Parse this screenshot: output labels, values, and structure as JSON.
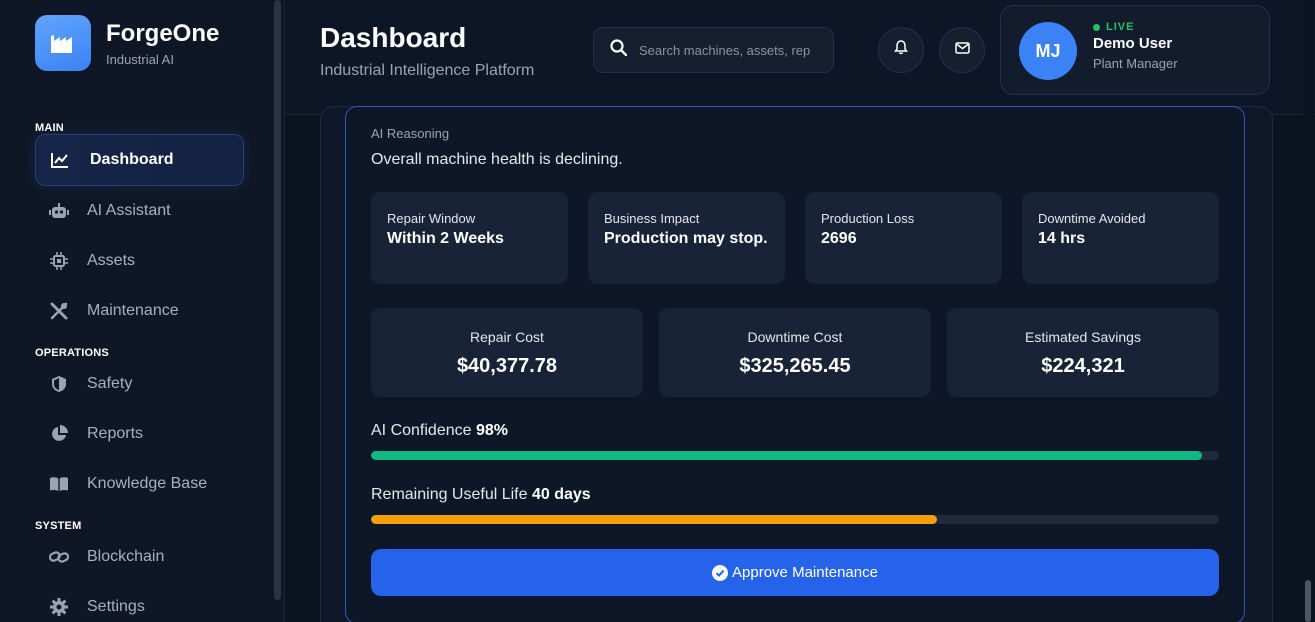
{
  "brand": {
    "name": "ForgeOne",
    "subtitle": "Industrial AI"
  },
  "sidebar": {
    "sections": [
      {
        "title": "MAIN",
        "items": [
          {
            "label": "Dashboard",
            "icon": "chart-line-icon",
            "active": true
          },
          {
            "label": "AI Assistant",
            "icon": "robot-icon"
          },
          {
            "label": "Assets",
            "icon": "chip-icon"
          },
          {
            "label": "Maintenance",
            "icon": "tools-icon"
          }
        ]
      },
      {
        "title": "OPERATIONS",
        "items": [
          {
            "label": "Safety",
            "icon": "shield-icon"
          },
          {
            "label": "Reports",
            "icon": "pie-chart-icon"
          },
          {
            "label": "Knowledge Base",
            "icon": "book-icon"
          }
        ]
      },
      {
        "title": "SYSTEM",
        "items": [
          {
            "label": "Blockchain",
            "icon": "link-icon"
          },
          {
            "label": "Settings",
            "icon": "gear-icon"
          }
        ]
      }
    ]
  },
  "header": {
    "title": "Dashboard",
    "subtitle": "Industrial Intelligence Platform",
    "search_placeholder": "Search machines, assets, rep"
  },
  "user": {
    "initials": "MJ",
    "status": "LIVE",
    "name": "Demo User",
    "role": "Plant Manager"
  },
  "card": {
    "reasoning_label": "AI Reasoning",
    "reasoning_text": "Overall machine health is declining.",
    "tiles": [
      {
        "label": "Repair Window",
        "value": "Within 2 Weeks"
      },
      {
        "label": "Business Impact",
        "value": "Production may stop."
      },
      {
        "label": "Production Loss",
        "value": "2696"
      },
      {
        "label": "Downtime Avoided",
        "value": "14 hrs"
      }
    ],
    "costs": [
      {
        "label": "Repair Cost",
        "value": "$40,377.78"
      },
      {
        "label": "Downtime Cost",
        "value": "$325,265.45"
      },
      {
        "label": "Estimated Savings",
        "value": "$224,321"
      }
    ],
    "confidence": {
      "label": "AI Confidence",
      "value": "98%",
      "fraction": 0.98,
      "color": "#10b981"
    },
    "rul": {
      "label": "Remaining Useful Life",
      "value": "40 days",
      "fraction": 0.667,
      "color": "#f59e0b"
    },
    "approve_label": "Approve Maintenance"
  },
  "colors": {
    "accent": "#3b82f6",
    "live": "#22c55e",
    "button": "#2563eb"
  }
}
